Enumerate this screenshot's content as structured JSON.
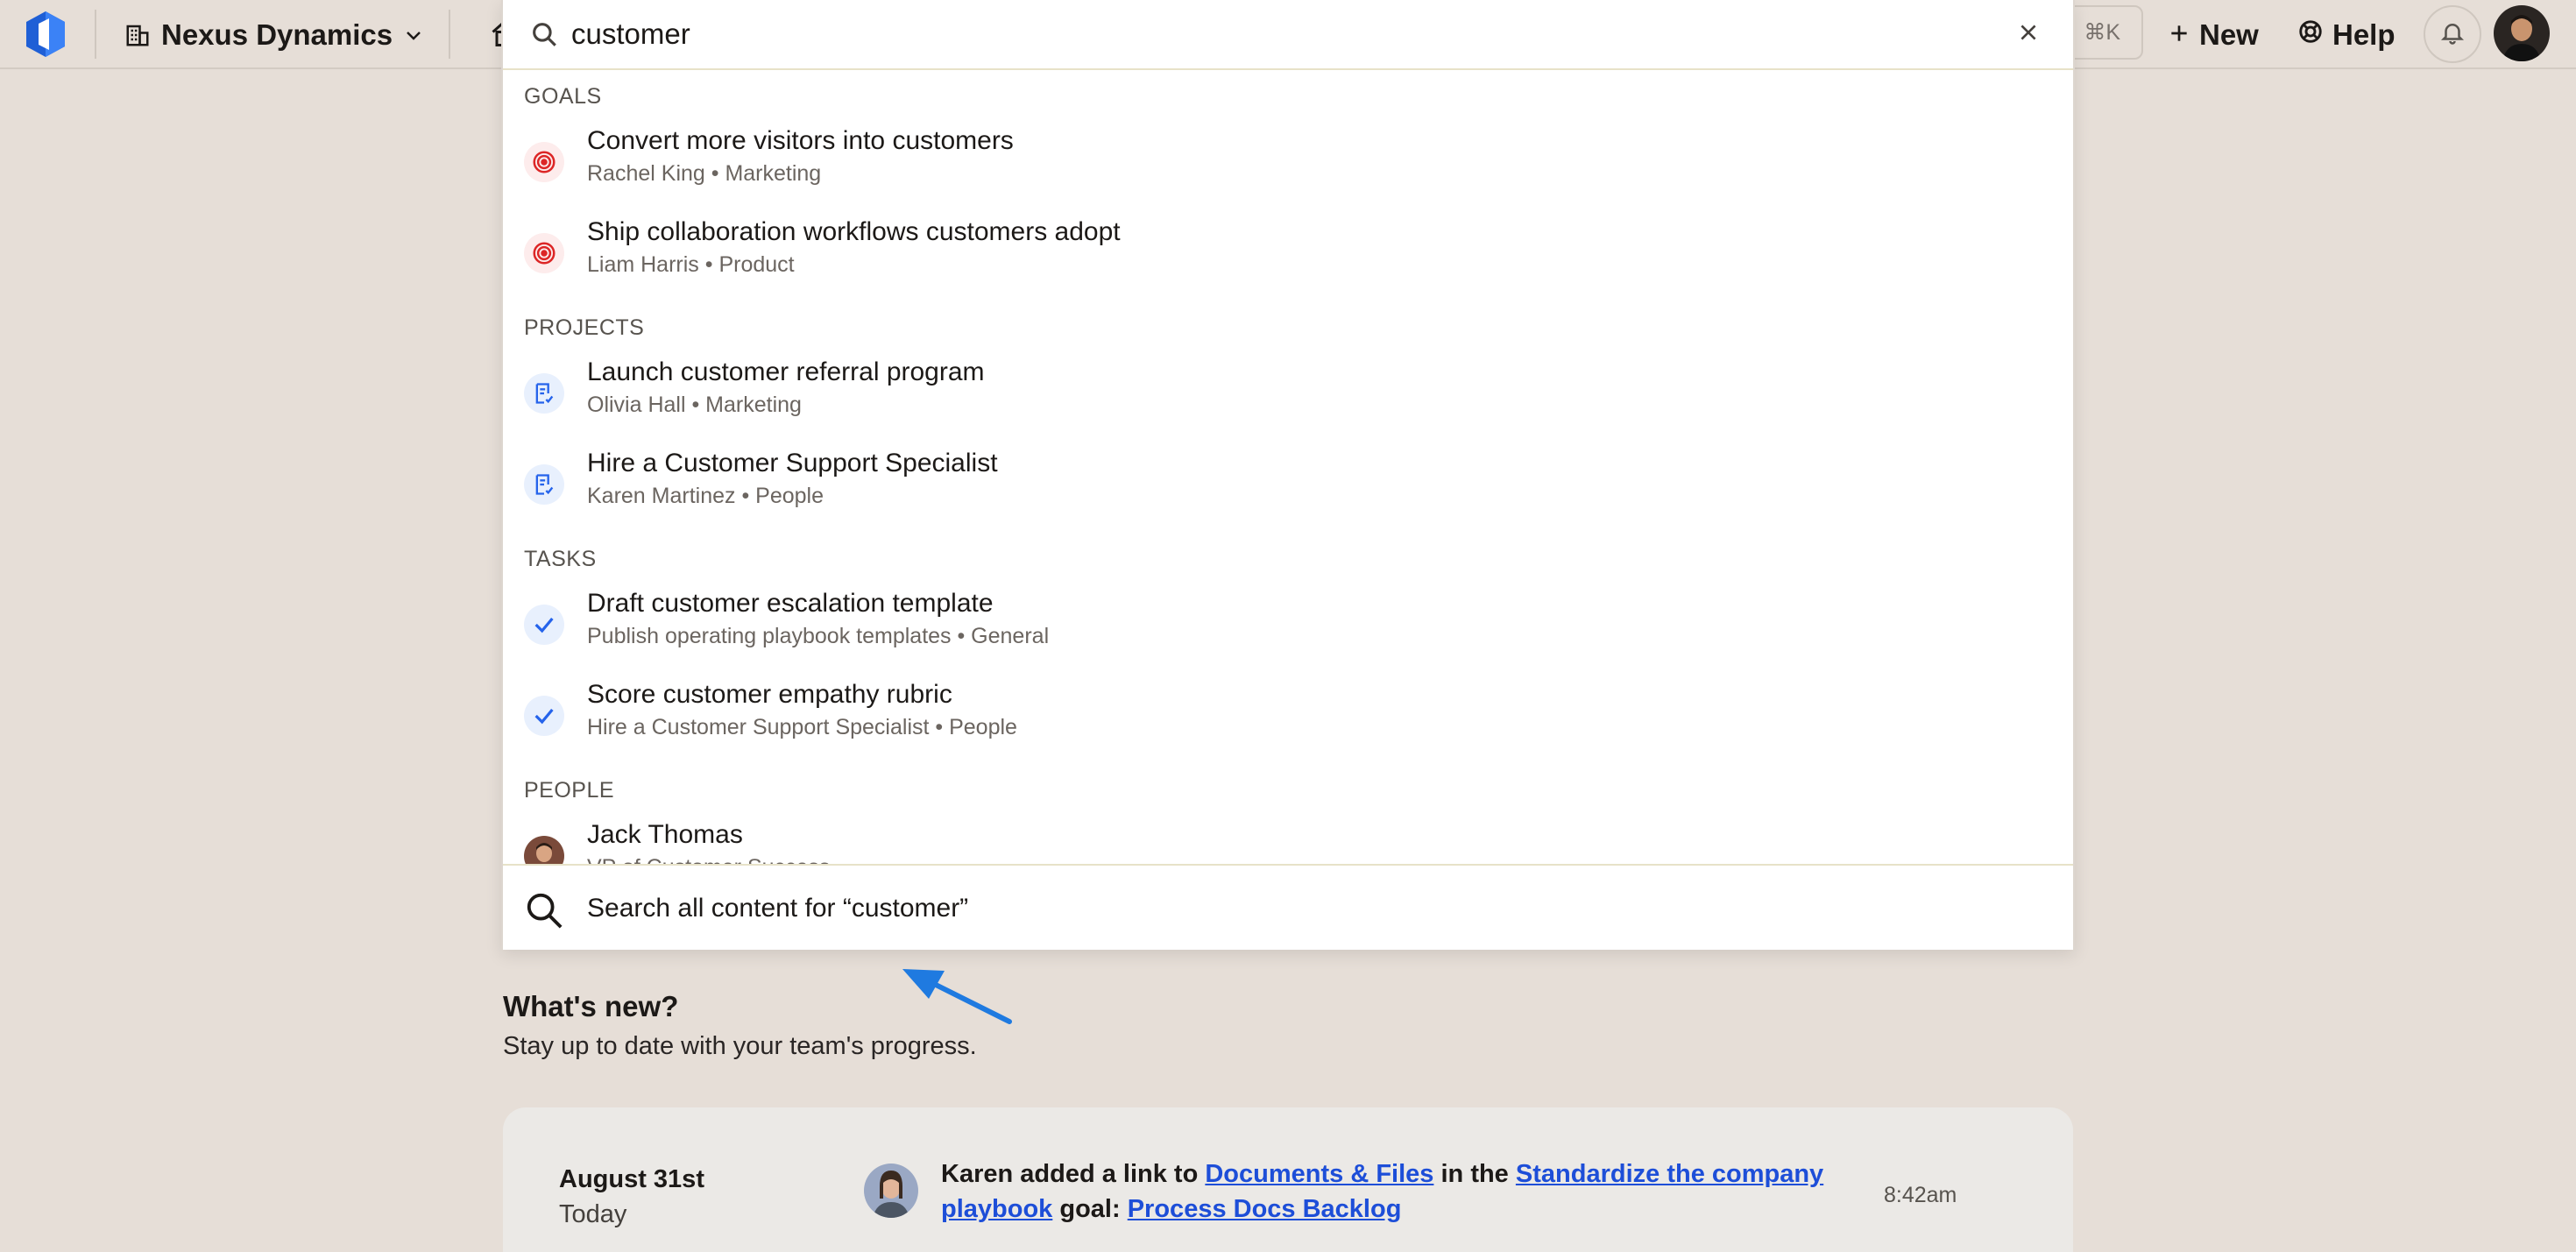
{
  "topbar": {
    "company_name": "Nexus Dynamics",
    "shortcut": "⌘K",
    "new_label": "New",
    "help_label": "Help"
  },
  "search": {
    "query": "customer",
    "sections": {
      "goals": "GOALS",
      "projects": "PROJECTS",
      "tasks": "TASKS",
      "people": "PEOPLE"
    },
    "goals": [
      {
        "title": "Convert more visitors into customers",
        "subtitle": "Rachel King • Marketing"
      },
      {
        "title": "Ship collaboration workflows customers adopt",
        "subtitle": "Liam Harris • Product"
      }
    ],
    "projects": [
      {
        "title": "Launch customer referral program",
        "subtitle": "Olivia Hall • Marketing"
      },
      {
        "title": "Hire a Customer Support Specialist",
        "subtitle": "Karen Martinez • People"
      }
    ],
    "tasks": [
      {
        "title": "Draft customer escalation template",
        "subtitle": "Publish operating playbook templates • General"
      },
      {
        "title": "Score customer empathy rubric",
        "subtitle": "Hire a Customer Support Specialist • People"
      }
    ],
    "people": [
      {
        "name": "Jack Thomas",
        "subtitle": "VP of Customer Success"
      }
    ],
    "search_all_label": "Search all content for “customer”"
  },
  "whats_new": {
    "title": "What's new?",
    "subtitle": "Stay up to date with your team's progress."
  },
  "feed": {
    "date": "August 31st",
    "day": "Today",
    "actor": "Karen added a link to",
    "link1": "Documents & Files",
    "mid": "in the",
    "link2": "Standardize the company playbook",
    "mid2": "goal:",
    "link3": "Process Docs Backlog",
    "time": "8:42am"
  },
  "colors": {
    "background": "#e6ded7",
    "goal_icon": "#dc2626",
    "project_icon": "#2563eb",
    "task_icon": "#2563eb",
    "link": "#1d4ed8",
    "pointer_arrow": "#1f7ae0"
  },
  "icons": [
    "logo-icon",
    "building-icon",
    "chevron-down-icon",
    "home-icon",
    "search-icon",
    "close-icon",
    "target-icon",
    "project-icon",
    "check-icon",
    "plus-icon",
    "help-icon",
    "bell-icon",
    "arrow-icon"
  ]
}
